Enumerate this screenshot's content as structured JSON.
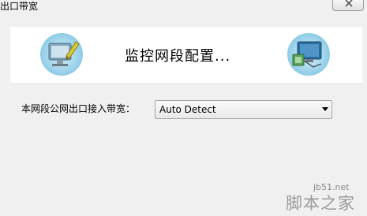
{
  "window": {
    "title": "出口带宽"
  },
  "banner": {
    "title": "监控网段配置..."
  },
  "form": {
    "bandwidth_label": "本网段公网出口接入带宽：",
    "bandwidth_value": "Auto Detect"
  },
  "watermark": {
    "site": "jb51.net",
    "name": "脚本之家"
  },
  "icons": {
    "left": "monitor-pencil-icon",
    "right": "monitor-network-icon",
    "close": "close-icon"
  }
}
